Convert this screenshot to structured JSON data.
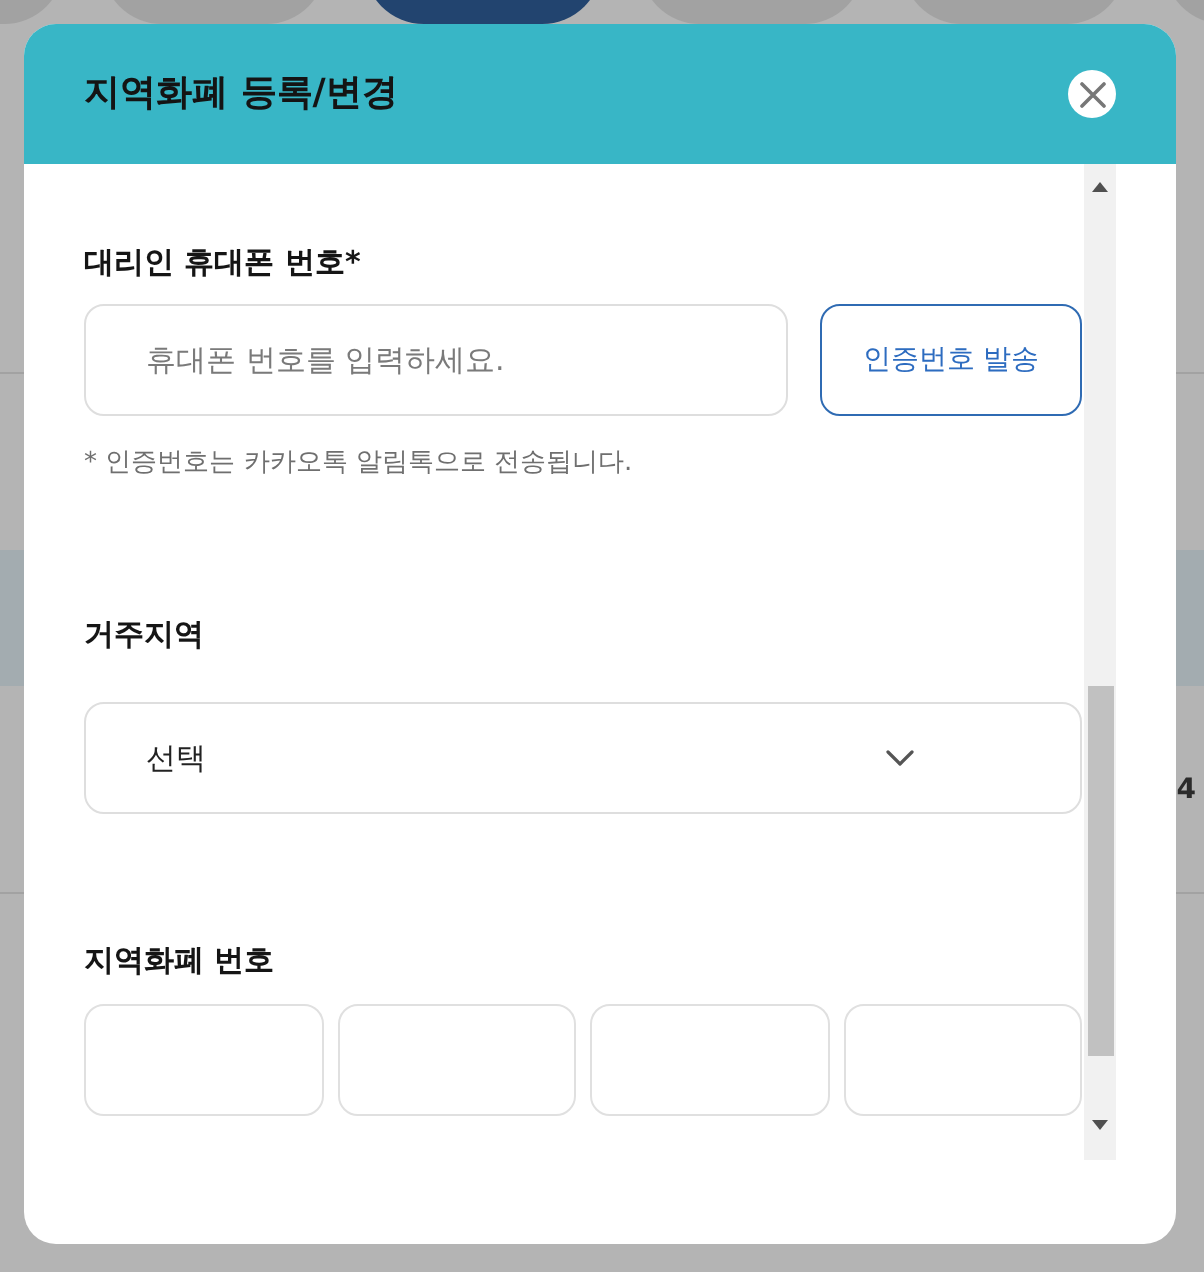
{
  "background": {
    "tabs": [
      {
        "selected": false
      },
      {
        "selected": false
      },
      {
        "selected": true
      },
      {
        "selected": false
      },
      {
        "selected": false
      },
      {
        "selected": false
      }
    ],
    "text_fragment": "4"
  },
  "dialog": {
    "title": "지역화폐 등록/변경"
  },
  "phone": {
    "label": "대리인 휴대폰 번호*",
    "placeholder": "휴대폰 번호를 입력하세요.",
    "button": "인증번호 발송",
    "note": "* 인증번호는 카카오톡 알림톡으로 전송됩니다."
  },
  "region": {
    "label": "거주지역",
    "value": "선택"
  },
  "currency_number": {
    "label": "지역화폐 번호"
  }
}
